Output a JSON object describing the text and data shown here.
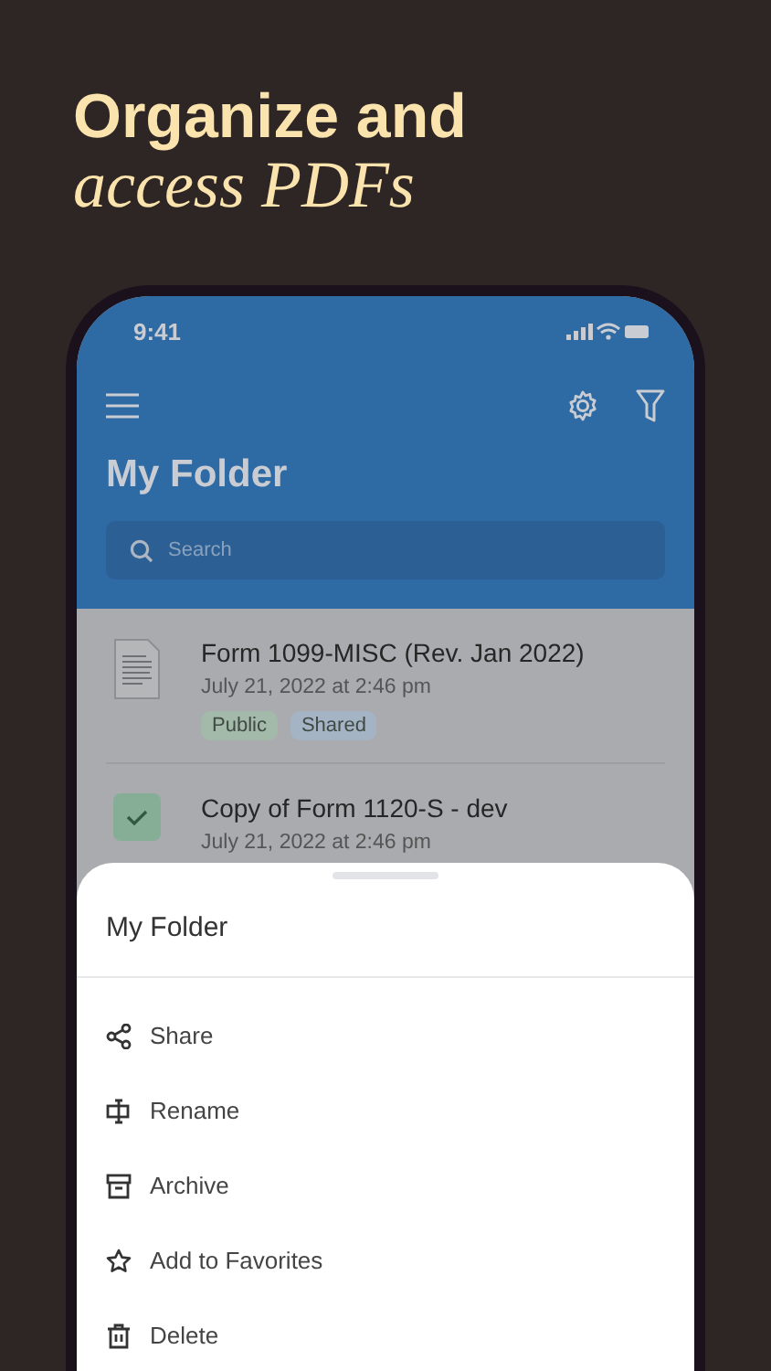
{
  "headline": {
    "line_1": "Organize and",
    "line_2": "access PDFs"
  },
  "status_bar": {
    "time": "9:41"
  },
  "header": {
    "title": "My Folder",
    "search": {
      "placeholder": "Search"
    }
  },
  "files": [
    {
      "name": "Form 1099-MISC (Rev. Jan 2022)",
      "date": "July 21, 2022 at 2:46 pm",
      "selected": false,
      "tags": [
        {
          "label": "Public",
          "color": "#a3b9a9"
        },
        {
          "label": "Shared",
          "color": "#a5b4c5"
        }
      ]
    },
    {
      "name": "Copy of Form 1120-S - dev",
      "date": "July 21, 2022 at 2:46 pm",
      "selected": true
    }
  ],
  "sheet": {
    "title": "My Folder",
    "actions": [
      {
        "label": "Share",
        "kind": "share"
      },
      {
        "label": "Rename",
        "kind": "rename"
      },
      {
        "label": "Archive",
        "kind": "archive"
      },
      {
        "label": "Add to Favorites",
        "kind": "favorite"
      },
      {
        "label": "Delete",
        "kind": "delete"
      }
    ]
  }
}
